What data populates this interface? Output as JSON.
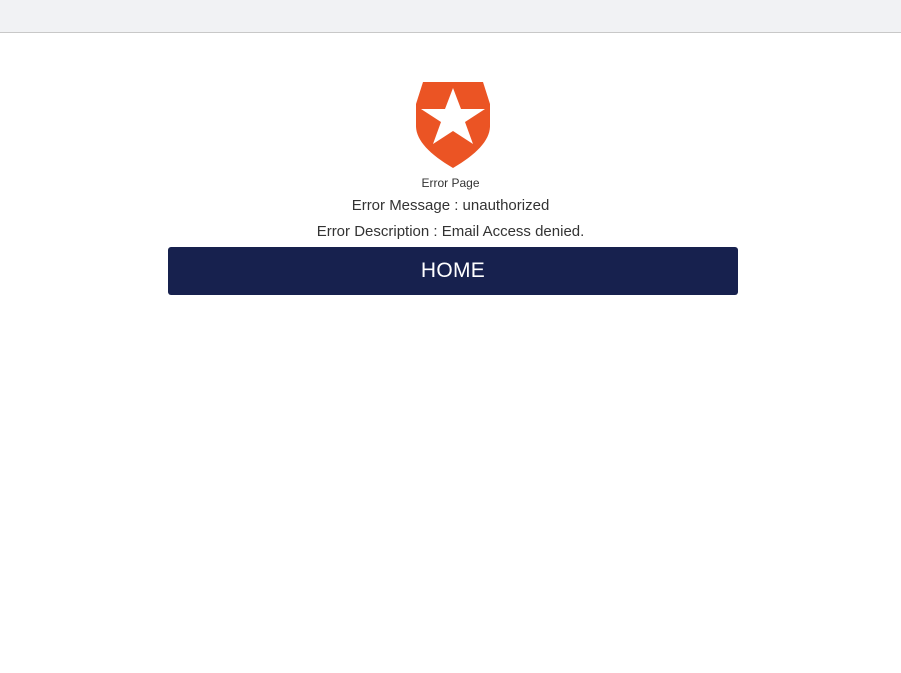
{
  "brand": {
    "logo_icon": "auth0-shield-star-icon",
    "accent_color": "#eb5424",
    "button_color": "#17214e"
  },
  "page": {
    "title": "Error Page",
    "error_message": "Error Message : unauthorized",
    "error_description": "Error Description : Email Access denied."
  },
  "actions": {
    "home_label": "HOME"
  }
}
